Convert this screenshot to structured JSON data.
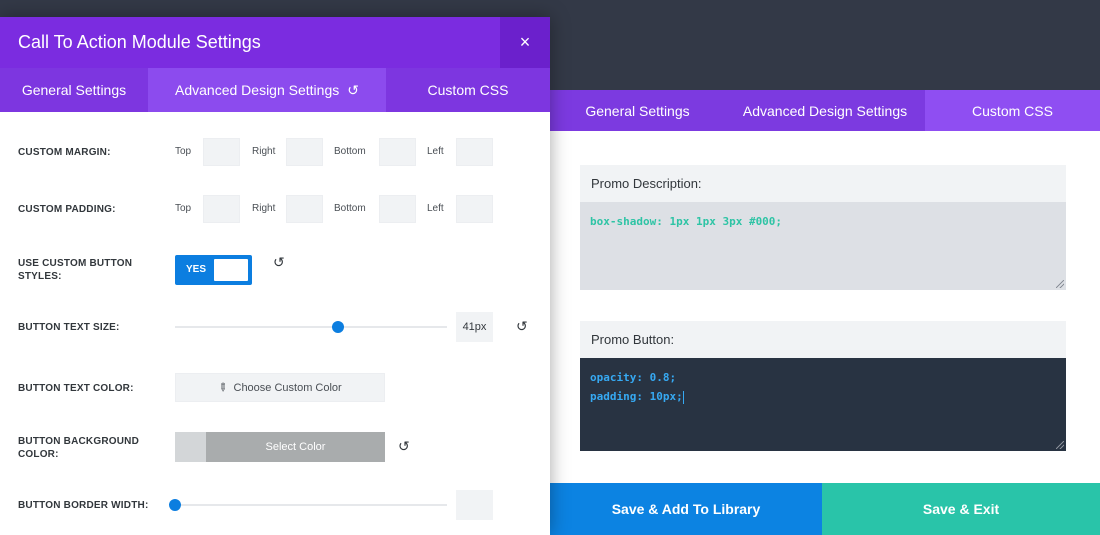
{
  "back": {
    "tabs": [
      {
        "label": "General Settings"
      },
      {
        "label": "Advanced Design Settings"
      },
      {
        "label": "Custom CSS"
      }
    ],
    "promo_description": {
      "label": "Promo Description:",
      "code": "box-shadow: 1px 1px 3px #000;"
    },
    "promo_button": {
      "label": "Promo Button:",
      "lines": [
        "opacity: 0.8;",
        "padding: 10px;"
      ]
    },
    "footer": {
      "save_library": "Save & Add To Library",
      "save_exit": "Save & Exit"
    }
  },
  "modal": {
    "title": "Call To Action Module Settings",
    "close_glyph": "×",
    "tabs": [
      {
        "label": "General Settings"
      },
      {
        "label": "Advanced Design Settings"
      },
      {
        "label": "Custom CSS"
      }
    ],
    "reset_glyph": "↺",
    "sides": {
      "top": "Top",
      "right": "Right",
      "bottom": "Bottom",
      "left": "Left"
    },
    "custom_margin": {
      "label": "CUSTOM MARGIN:"
    },
    "custom_padding": {
      "label": "CUSTOM PADDING:"
    },
    "custom_button_styles": {
      "label": "USE CUSTOM BUTTON STYLES:",
      "toggle_text": "YES",
      "enabled": true
    },
    "button_text_size": {
      "label": "BUTTON TEXT SIZE:",
      "value": "41px",
      "slider_fraction": 0.6
    },
    "button_text_color": {
      "label": "BUTTON TEXT COLOR:",
      "button_text": "Choose Custom Color"
    },
    "button_bg_color": {
      "label": "BUTTON BACKGROUND COLOR:",
      "button_text": "Select Color"
    },
    "button_border_width": {
      "label": "BUTTON BORDER WIDTH:",
      "value": "",
      "slider_fraction": 0.0
    }
  },
  "colors": {
    "purple_header": "#7b2ce0",
    "blue_accent": "#0c7ee0",
    "teal_accent": "#29c4a9",
    "dark_bg": "#333947"
  }
}
